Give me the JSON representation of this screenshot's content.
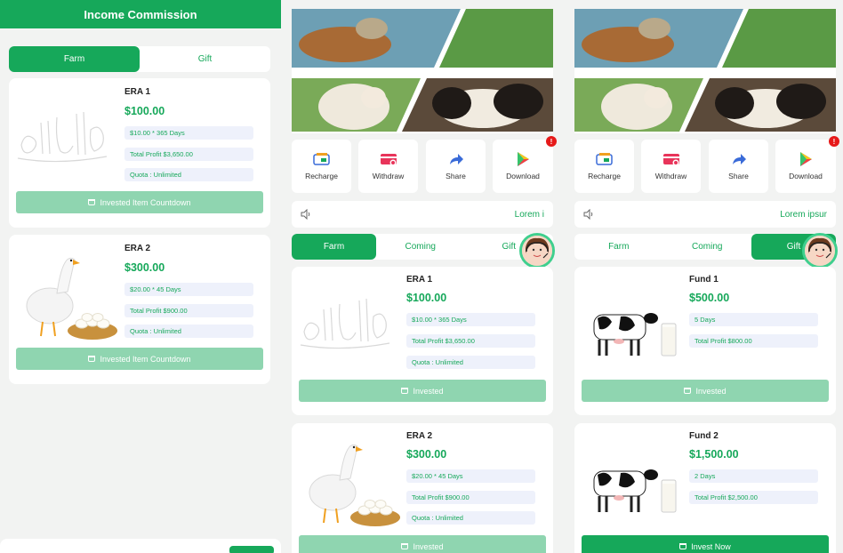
{
  "panel1": {
    "title": "Income Commission",
    "tabs": [
      "Farm",
      "Gift"
    ],
    "cards": [
      {
        "title": "ERA 1",
        "price": "$100.00",
        "details": [
          "$10.00 * 365 Days",
          "Total Profit $3,650.00",
          "Quota : Unlimited"
        ],
        "button": "Invested Item Countdown"
      },
      {
        "title": "ERA 2",
        "price": "$300.00",
        "details": [
          "$20.00 * 45 Days",
          "Total Profit $900.00",
          "Quota : Unlimited"
        ],
        "button": "Invested Item Countdown"
      }
    ]
  },
  "panel2": {
    "actions": [
      "Recharge",
      "Withdraw",
      "Share",
      "Download"
    ],
    "badge": "!",
    "notice": "Lorem i",
    "tabs": [
      "Farm",
      "Coming",
      "Gift"
    ],
    "cards": [
      {
        "title": "ERA 1",
        "price": "$100.00",
        "details": [
          "$10.00 * 365 Days",
          "Total Profit $3,650.00",
          "Quota : Unlimited"
        ],
        "button": "Invested"
      },
      {
        "title": "ERA 2",
        "price": "$300.00",
        "details": [
          "$20.00 * 45 Days",
          "Total Profit $900.00",
          "Quota : Unlimited"
        ],
        "button": "Invested"
      }
    ]
  },
  "panel3": {
    "actions": [
      "Recharge",
      "Withdraw",
      "Share",
      "Download"
    ],
    "badge": "!",
    "notice": "Lorem ipsur",
    "tabs": [
      "Farm",
      "Coming",
      "Gift"
    ],
    "cards": [
      {
        "title": "Fund 1",
        "price": "$500.00",
        "details": [
          "5 Days",
          "Total Profit $800.00"
        ],
        "button": "Invested"
      },
      {
        "title": "Fund 2",
        "price": "$1,500.00",
        "details": [
          "2 Days",
          "Total Profit $2,500.00"
        ],
        "button": "Invest Now"
      }
    ]
  },
  "colors": {
    "primary": "#16a85a",
    "light": "#8fd5b0",
    "pill": "#eef1fb",
    "badge": "#e61919"
  }
}
